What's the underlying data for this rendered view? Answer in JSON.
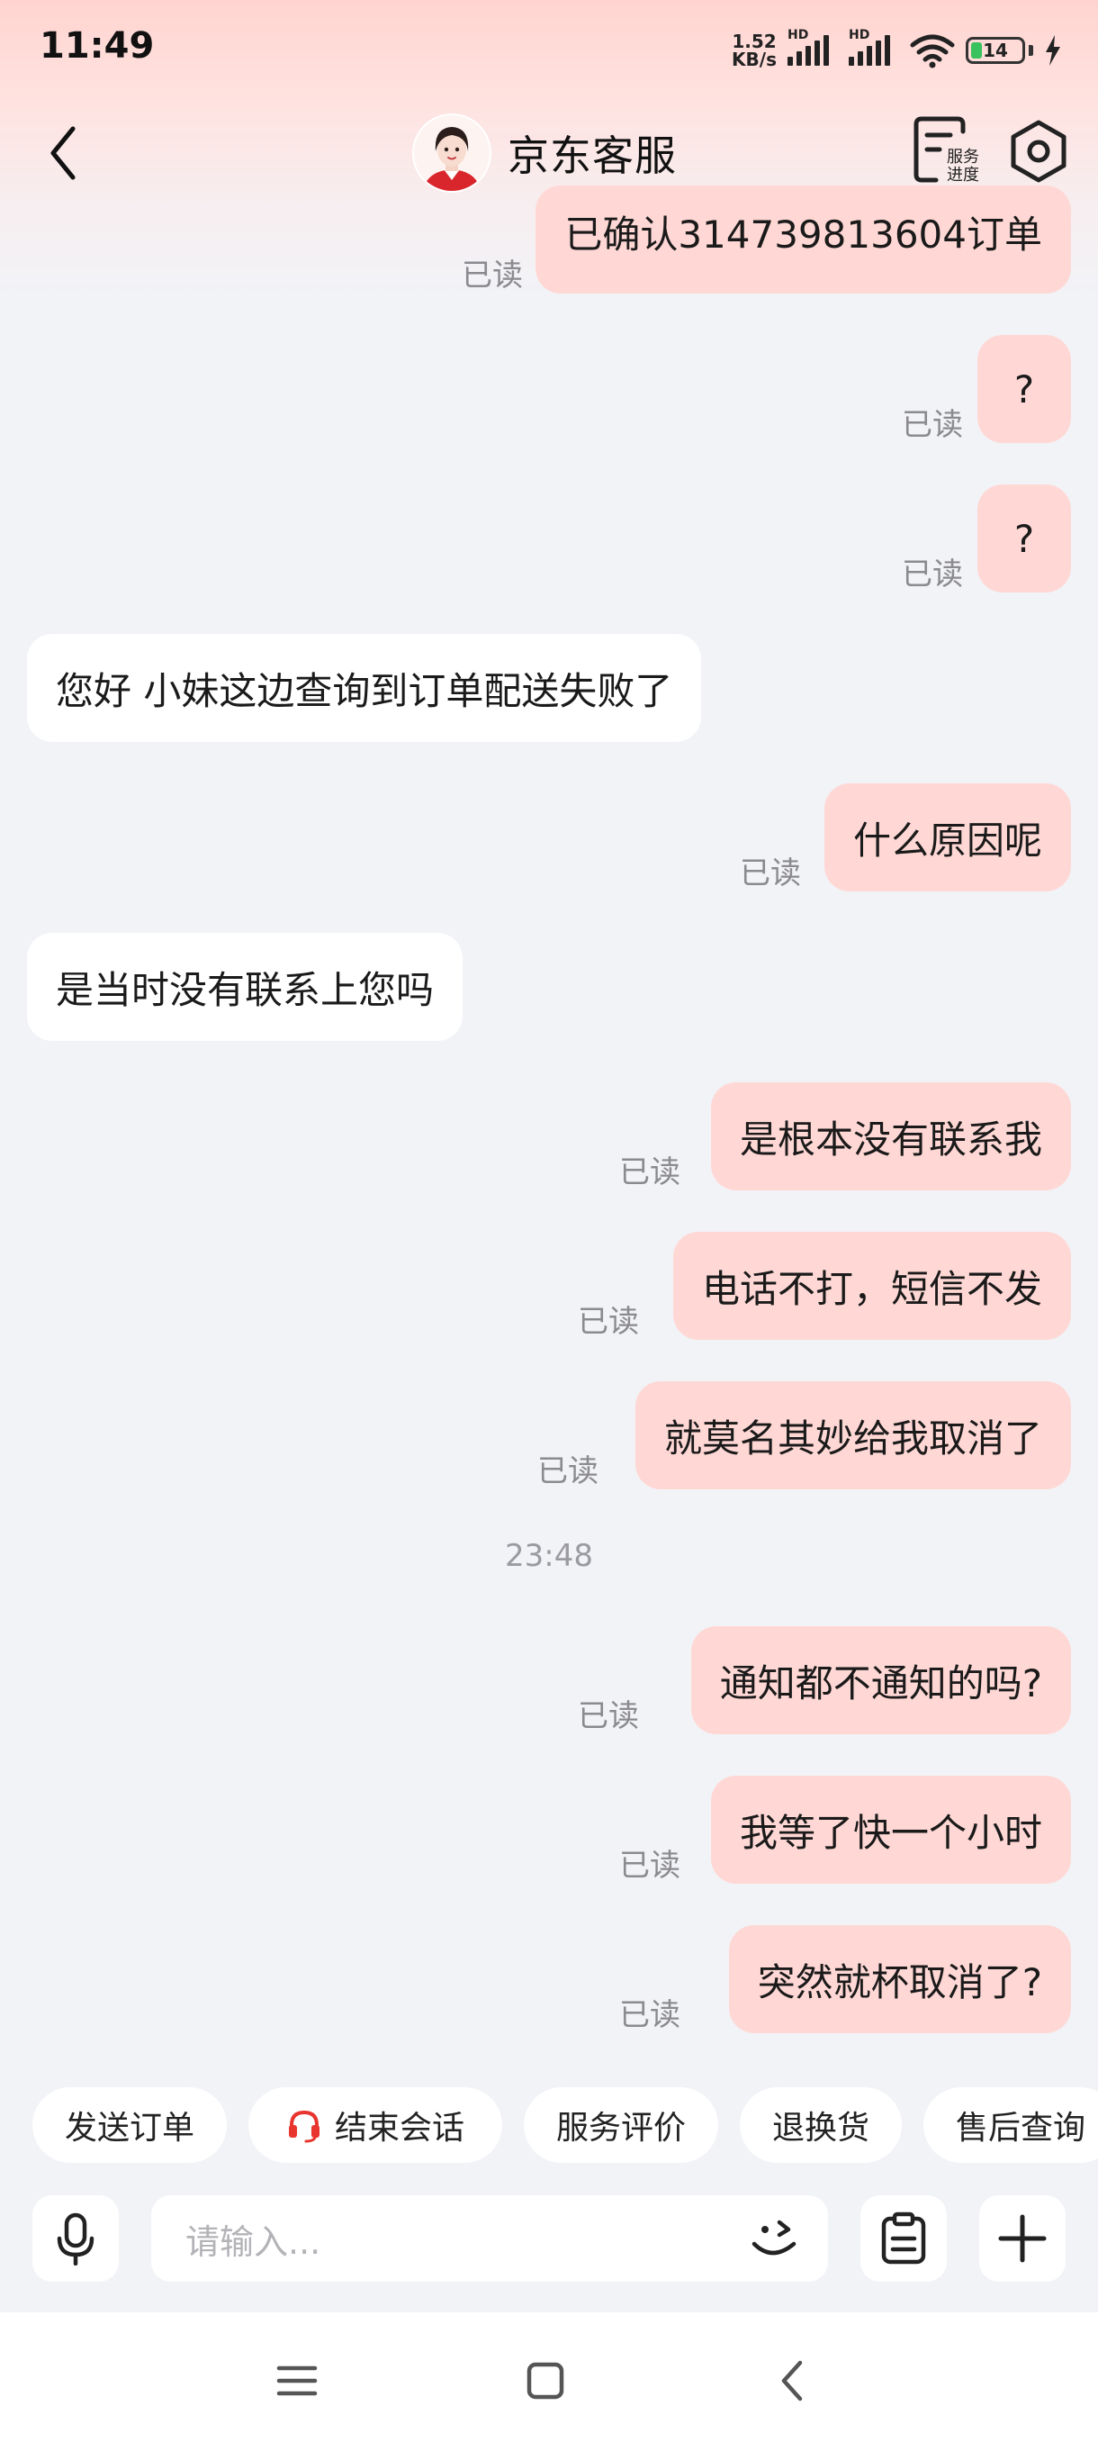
{
  "status_bar": {
    "time": "11:49",
    "net_speed_value": "1.52",
    "net_speed_unit": "KB/s",
    "signal_tag": "HD",
    "battery_level": "14"
  },
  "header": {
    "title": "京东客服",
    "progress_label_line1": "服务",
    "progress_label_line2": "进度"
  },
  "read_label": "已读",
  "messages": [
    {
      "text": "已确认314739813604订单",
      "read": "已读"
    },
    {
      "text": "?",
      "read": "已读"
    },
    {
      "text": "?",
      "read": "已读"
    },
    {
      "text": "您好 小妹这边查询到订单配送失败了"
    },
    {
      "text": "什么原因呢",
      "read": "已读"
    },
    {
      "text": "是当时没有联系上您吗"
    },
    {
      "text": "是根本没有联系我",
      "read": "已读"
    },
    {
      "text": "电话不打，短信不发",
      "read": "已读"
    },
    {
      "text": "就莫名其妙给我取消了",
      "read": "已读"
    },
    {
      "text": "通知都不通知的吗?",
      "read": "已读"
    },
    {
      "text": "我等了快一个小时",
      "read": "已读"
    },
    {
      "text": "突然就杯取消了?",
      "read": "已读"
    }
  ],
  "timestamp": "23:48",
  "quick_actions": [
    {
      "label": "发送订单"
    },
    {
      "label": "结束会话",
      "icon": "headset-icon"
    },
    {
      "label": "服务评价"
    },
    {
      "label": "退换货"
    },
    {
      "label": "售后查询"
    }
  ],
  "input": {
    "placeholder": "请输入..."
  },
  "colors": {
    "accent": "#e8352d",
    "my_bubble": "#ffd8d5",
    "agent_bubble": "#ffffff",
    "background": "#f2f3f7"
  }
}
